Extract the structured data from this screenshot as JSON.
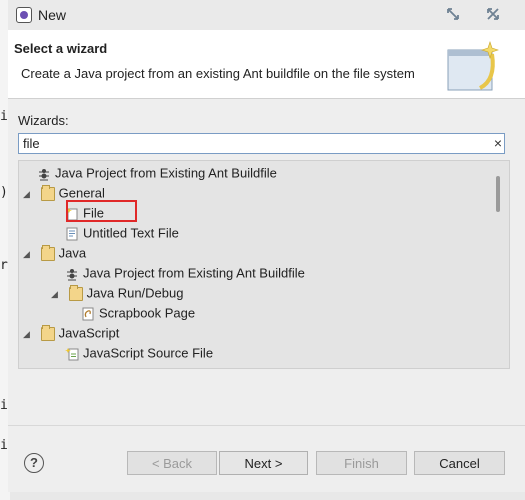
{
  "window": {
    "title": "New"
  },
  "header": {
    "title": "Select a wizard",
    "description": "Create a Java project from an existing Ant buildfile on the file system"
  },
  "wizards": {
    "label": "Wizards:",
    "filter_value": "file",
    "clear_icon": "×"
  },
  "tree": [
    {
      "label": "Java Project from Existing Ant Buildfile",
      "icon": "ant-icon",
      "level": 1,
      "expanded": null
    },
    {
      "label": "General",
      "icon": "folder-icon",
      "level": 0,
      "expanded": true
    },
    {
      "label": "File",
      "icon": "file-icon",
      "level": 1,
      "expanded": null,
      "highlighted": true
    },
    {
      "label": "Untitled Text File",
      "icon": "text-file-icon",
      "level": 1,
      "expanded": null
    },
    {
      "label": "Java",
      "icon": "folder-icon",
      "level": 0,
      "expanded": true
    },
    {
      "label": "Java Project from Existing Ant Buildfile",
      "icon": "ant-icon",
      "level": 1,
      "expanded": null
    },
    {
      "label": "Java Run/Debug",
      "icon": "folder-icon",
      "level": 1,
      "expanded": true
    },
    {
      "label": "Scrapbook Page",
      "icon": "scrapbook-icon",
      "level": 2,
      "expanded": null
    },
    {
      "label": "JavaScript",
      "icon": "folder-icon",
      "level": 0,
      "expanded": true
    },
    {
      "label": "JavaScript Source File",
      "icon": "js-file-icon",
      "level": 1,
      "expanded": null
    }
  ],
  "buttons": {
    "help": "?",
    "back": "< Back",
    "next": "Next >",
    "finish": "Finish",
    "cancel": "Cancel"
  },
  "editor_edge": {
    "c1": "i",
    "c2": ")",
    "c3": "r",
    "c4": "i",
    "c5": "i"
  }
}
